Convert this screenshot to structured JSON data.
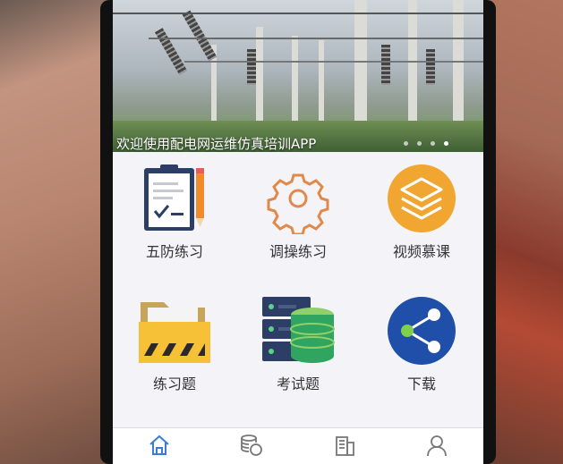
{
  "banner": {
    "caption": "欢迎使用配电网运维仿真培训APP",
    "page_count": 4,
    "active_page": 4
  },
  "grid": {
    "items": [
      {
        "label": "五防练习",
        "icon": "clipboard-pencil-icon"
      },
      {
        "label": "调操练习",
        "icon": "gear-icon"
      },
      {
        "label": "视频慕课",
        "icon": "layers-icon"
      },
      {
        "label": "练习题",
        "icon": "folder-icon"
      },
      {
        "label": "考试题",
        "icon": "database-server-icon"
      },
      {
        "label": "下载",
        "icon": "share-icon"
      }
    ]
  },
  "tabbar": {
    "tabs": [
      {
        "icon": "home-icon",
        "active": true,
        "color": "#3a7bd5"
      },
      {
        "icon": "coins-icon",
        "active": false
      },
      {
        "icon": "building-icon",
        "active": false
      },
      {
        "icon": "user-icon",
        "active": false
      }
    ]
  },
  "colors": {
    "accent": "#3a7bd5",
    "video_orange": "#f0a630",
    "download_blue": "#1f4fa8"
  }
}
